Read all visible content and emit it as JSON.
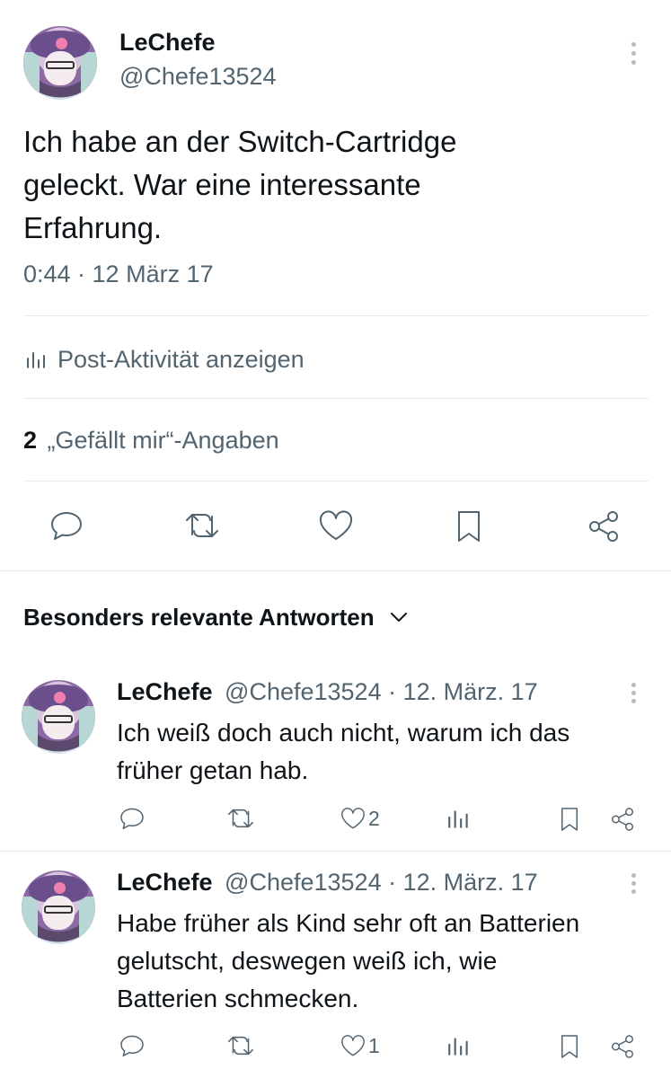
{
  "post": {
    "display_name": "LeChefe",
    "handle": "@Chefe13524",
    "text_lines": [
      "Ich habe an der Switch-Cartridge",
      "geleckt. War eine interessante",
      "Erfahrung."
    ],
    "timestamp": "0:44 · 12 März 17",
    "activity_label": "Post-Aktivität anzeigen",
    "likes_count": "2",
    "likes_label": "„Gefällt mir“-Angaben"
  },
  "replies_header": {
    "label": "Besonders relevante Antworten"
  },
  "replies": [
    {
      "display_name": "LeChefe",
      "handle_date": "@Chefe13524 · 12. März. 17",
      "text_lines": [
        "Ich weiß doch auch nicht, warum ich das",
        "früher getan hab."
      ],
      "like_count": "2"
    },
    {
      "display_name": "LeChefe",
      "handle_date": "@Chefe13524 · 12. März. 17",
      "text_lines": [
        "Habe früher als Kind sehr oft an Batterien",
        "gelutscht, deswegen weiß ich, wie",
        "Batterien schmecken."
      ],
      "like_count": "1"
    }
  ],
  "icons": [
    "more-vertical-icon",
    "analytics-icon",
    "reply-icon",
    "repost-icon",
    "like-icon",
    "bookmark-icon",
    "share-icon",
    "chevron-down-icon"
  ],
  "colors": {
    "text": "#0f1419",
    "muted": "#536471",
    "divider": "#e6ecf0"
  }
}
